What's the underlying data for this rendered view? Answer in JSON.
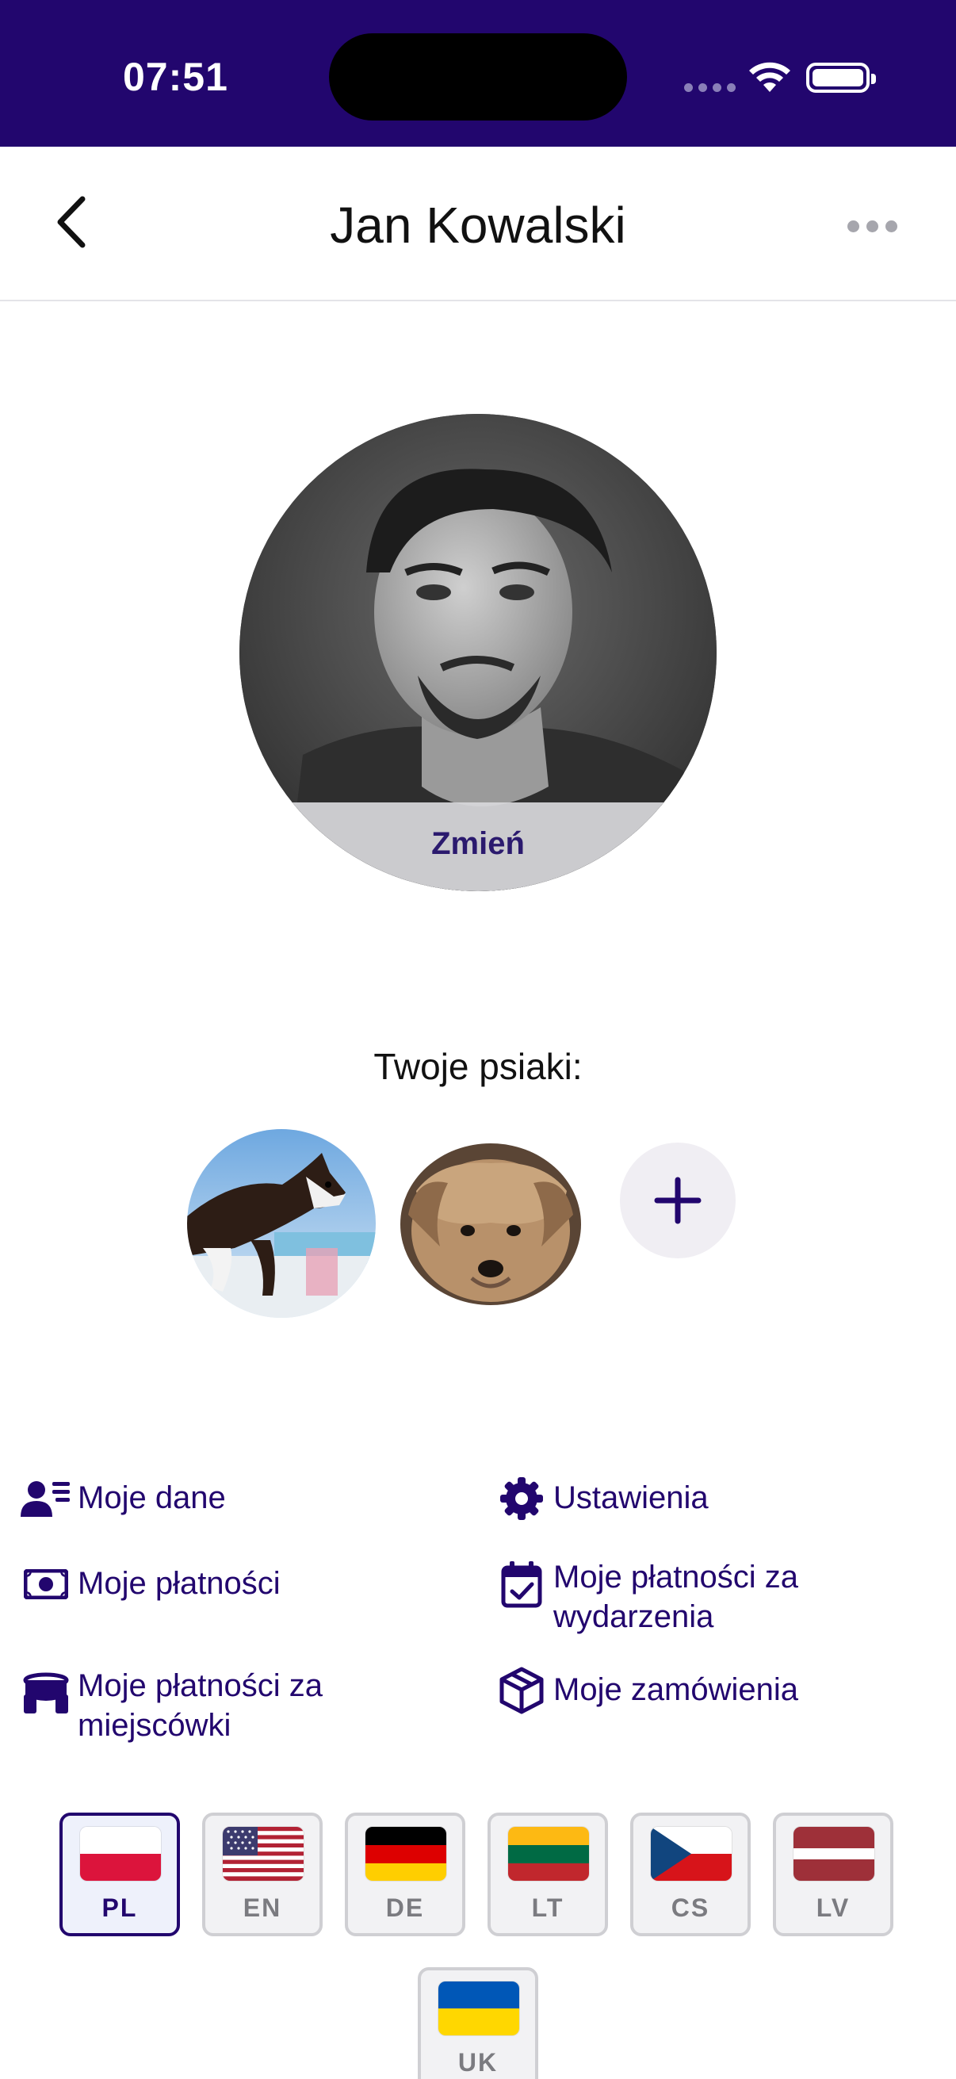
{
  "status_bar": {
    "time": "07:51"
  },
  "nav": {
    "title": "Jan Kowalski"
  },
  "profile": {
    "change_label": "Zmień"
  },
  "dogs": {
    "title": "Twoje psiaki:"
  },
  "menu": {
    "my_data": "Moje dane",
    "settings": "Ustawienia",
    "my_payments": "Moje płatności",
    "event_payments": "Moje płatności za wydarzenia",
    "spot_payments": "Moje płatności za miejscówki",
    "orders": "Moje zamówienia"
  },
  "languages": [
    {
      "code": "PL",
      "selected": true
    },
    {
      "code": "EN",
      "selected": false
    },
    {
      "code": "DE",
      "selected": false
    },
    {
      "code": "LT",
      "selected": false
    },
    {
      "code": "CS",
      "selected": false
    },
    {
      "code": "LV",
      "selected": false
    },
    {
      "code": "UK",
      "selected": false
    }
  ],
  "colors": {
    "brand": "#22066e",
    "accent_bg": "#f0eef3"
  }
}
